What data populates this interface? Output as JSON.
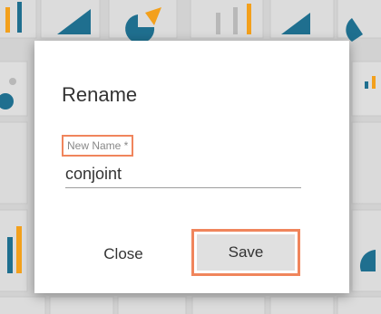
{
  "dialog": {
    "title": "Rename",
    "field": {
      "label": "New Name *",
      "value": "conjoint"
    },
    "buttons": {
      "close_label": "Close",
      "save_label": "Save"
    }
  },
  "colors": {
    "highlight": "#f0855c",
    "chart_blue": "#1f6f8f",
    "chart_orange": "#f3a01c",
    "chart_gray": "#b8b8b8",
    "overlay": "#d6d6d6"
  },
  "background_icons": [
    "bar-chart-icon",
    "area-chart-icon",
    "pie-chart-icon",
    "scatter-chart-icon"
  ]
}
